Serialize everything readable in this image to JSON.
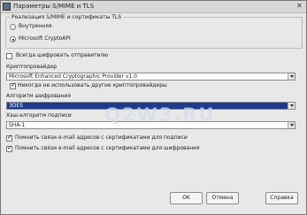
{
  "window": {
    "title": "Параметры S/MIME и TLS",
    "close_label": "✕"
  },
  "implementation": {
    "legend": "Реализация S/MIME и сертификаты TLS",
    "options": [
      {
        "label": "Внутренняя",
        "selected": false
      },
      {
        "label": "Microsoft CryptoAPI",
        "selected": true
      }
    ]
  },
  "always_encrypt": {
    "label": "Всегда шифровать отправителю",
    "checked": false
  },
  "provider": {
    "label": "Криптопровайдер",
    "value": "Microsoft Enhanced Cryptographic Provider v1.0",
    "never_use_others": {
      "label": "Никогда не использовать другие криптопровайдеры",
      "checked": true
    }
  },
  "encryption": {
    "label": "Алгоритм шифрования",
    "value": "3DES"
  },
  "hash": {
    "label": "Хэш-алгоритм подписи",
    "value": "SHA-1"
  },
  "remember_signing": {
    "label": "Помнить связи e-mail адресов с сертификатами для подписи",
    "checked": true
  },
  "remember_encrypting": {
    "label": "Помнить связи e-mail адресов с сертификатами для шифрования",
    "checked": true
  },
  "watermark": "Q2W3.RU",
  "buttons": {
    "ok": "OK",
    "cancel": "Отмена",
    "help": "Справка"
  }
}
